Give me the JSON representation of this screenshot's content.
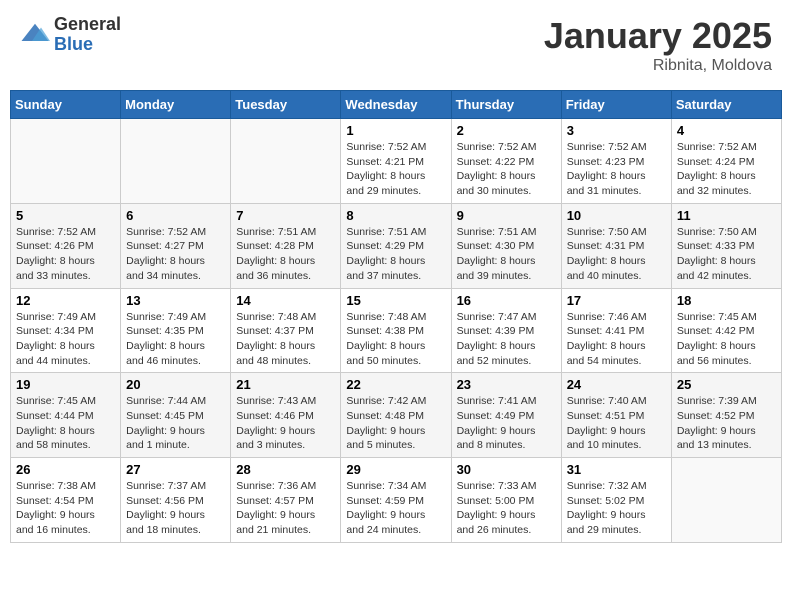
{
  "header": {
    "logo_general": "General",
    "logo_blue": "Blue",
    "title": "January 2025",
    "subtitle": "Ribnita, Moldova"
  },
  "weekdays": [
    "Sunday",
    "Monday",
    "Tuesday",
    "Wednesday",
    "Thursday",
    "Friday",
    "Saturday"
  ],
  "weeks": [
    [
      {
        "day": "",
        "info": ""
      },
      {
        "day": "",
        "info": ""
      },
      {
        "day": "",
        "info": ""
      },
      {
        "day": "1",
        "info": "Sunrise: 7:52 AM\nSunset: 4:21 PM\nDaylight: 8 hours and 29 minutes."
      },
      {
        "day": "2",
        "info": "Sunrise: 7:52 AM\nSunset: 4:22 PM\nDaylight: 8 hours and 30 minutes."
      },
      {
        "day": "3",
        "info": "Sunrise: 7:52 AM\nSunset: 4:23 PM\nDaylight: 8 hours and 31 minutes."
      },
      {
        "day": "4",
        "info": "Sunrise: 7:52 AM\nSunset: 4:24 PM\nDaylight: 8 hours and 32 minutes."
      }
    ],
    [
      {
        "day": "5",
        "info": "Sunrise: 7:52 AM\nSunset: 4:26 PM\nDaylight: 8 hours and 33 minutes."
      },
      {
        "day": "6",
        "info": "Sunrise: 7:52 AM\nSunset: 4:27 PM\nDaylight: 8 hours and 34 minutes."
      },
      {
        "day": "7",
        "info": "Sunrise: 7:51 AM\nSunset: 4:28 PM\nDaylight: 8 hours and 36 minutes."
      },
      {
        "day": "8",
        "info": "Sunrise: 7:51 AM\nSunset: 4:29 PM\nDaylight: 8 hours and 37 minutes."
      },
      {
        "day": "9",
        "info": "Sunrise: 7:51 AM\nSunset: 4:30 PM\nDaylight: 8 hours and 39 minutes."
      },
      {
        "day": "10",
        "info": "Sunrise: 7:50 AM\nSunset: 4:31 PM\nDaylight: 8 hours and 40 minutes."
      },
      {
        "day": "11",
        "info": "Sunrise: 7:50 AM\nSunset: 4:33 PM\nDaylight: 8 hours and 42 minutes."
      }
    ],
    [
      {
        "day": "12",
        "info": "Sunrise: 7:49 AM\nSunset: 4:34 PM\nDaylight: 8 hours and 44 minutes."
      },
      {
        "day": "13",
        "info": "Sunrise: 7:49 AM\nSunset: 4:35 PM\nDaylight: 8 hours and 46 minutes."
      },
      {
        "day": "14",
        "info": "Sunrise: 7:48 AM\nSunset: 4:37 PM\nDaylight: 8 hours and 48 minutes."
      },
      {
        "day": "15",
        "info": "Sunrise: 7:48 AM\nSunset: 4:38 PM\nDaylight: 8 hours and 50 minutes."
      },
      {
        "day": "16",
        "info": "Sunrise: 7:47 AM\nSunset: 4:39 PM\nDaylight: 8 hours and 52 minutes."
      },
      {
        "day": "17",
        "info": "Sunrise: 7:46 AM\nSunset: 4:41 PM\nDaylight: 8 hours and 54 minutes."
      },
      {
        "day": "18",
        "info": "Sunrise: 7:45 AM\nSunset: 4:42 PM\nDaylight: 8 hours and 56 minutes."
      }
    ],
    [
      {
        "day": "19",
        "info": "Sunrise: 7:45 AM\nSunset: 4:44 PM\nDaylight: 8 hours and 58 minutes."
      },
      {
        "day": "20",
        "info": "Sunrise: 7:44 AM\nSunset: 4:45 PM\nDaylight: 9 hours and 1 minute."
      },
      {
        "day": "21",
        "info": "Sunrise: 7:43 AM\nSunset: 4:46 PM\nDaylight: 9 hours and 3 minutes."
      },
      {
        "day": "22",
        "info": "Sunrise: 7:42 AM\nSunset: 4:48 PM\nDaylight: 9 hours and 5 minutes."
      },
      {
        "day": "23",
        "info": "Sunrise: 7:41 AM\nSunset: 4:49 PM\nDaylight: 9 hours and 8 minutes."
      },
      {
        "day": "24",
        "info": "Sunrise: 7:40 AM\nSunset: 4:51 PM\nDaylight: 9 hours and 10 minutes."
      },
      {
        "day": "25",
        "info": "Sunrise: 7:39 AM\nSunset: 4:52 PM\nDaylight: 9 hours and 13 minutes."
      }
    ],
    [
      {
        "day": "26",
        "info": "Sunrise: 7:38 AM\nSunset: 4:54 PM\nDaylight: 9 hours and 16 minutes."
      },
      {
        "day": "27",
        "info": "Sunrise: 7:37 AM\nSunset: 4:56 PM\nDaylight: 9 hours and 18 minutes."
      },
      {
        "day": "28",
        "info": "Sunrise: 7:36 AM\nSunset: 4:57 PM\nDaylight: 9 hours and 21 minutes."
      },
      {
        "day": "29",
        "info": "Sunrise: 7:34 AM\nSunset: 4:59 PM\nDaylight: 9 hours and 24 minutes."
      },
      {
        "day": "30",
        "info": "Sunrise: 7:33 AM\nSunset: 5:00 PM\nDaylight: 9 hours and 26 minutes."
      },
      {
        "day": "31",
        "info": "Sunrise: 7:32 AM\nSunset: 5:02 PM\nDaylight: 9 hours and 29 minutes."
      },
      {
        "day": "",
        "info": ""
      }
    ]
  ]
}
